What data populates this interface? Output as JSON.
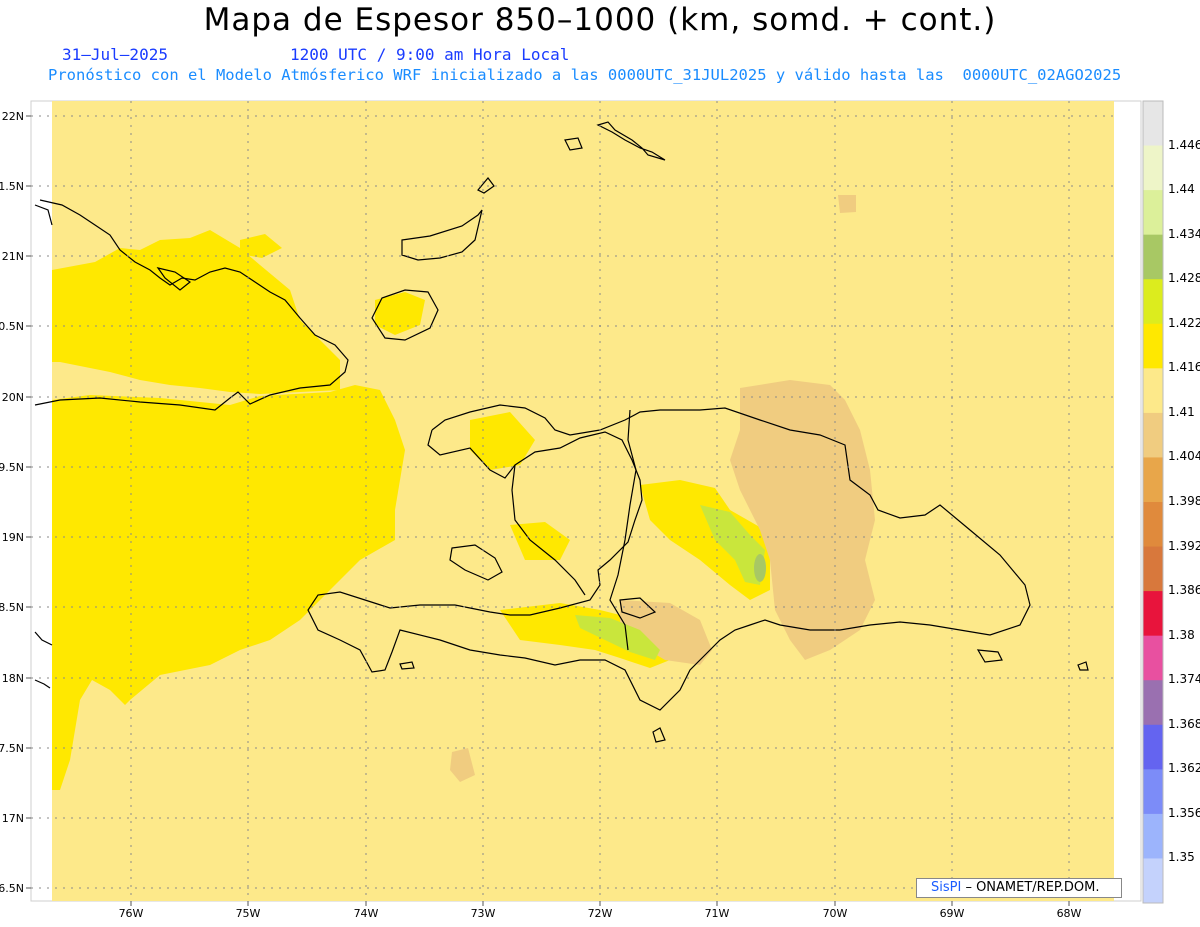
{
  "header": {
    "title": "Mapa de Espesor 850–1000 (km, somd. + cont.)",
    "date": "31–Jul–2025",
    "time": "1200 UTC / 9:00 am Hora Local",
    "forecast": "Pronóstico con el Modelo Atmósferico WRF inicializado a las 0000UTC_31JUL2025 y válido hasta las  0000UTC_02AGO2025"
  },
  "map": {
    "lat_labels": [
      "22N",
      "1.5N",
      "21N",
      "0.5N",
      "20N",
      "9.5N",
      "19N",
      "8.5N",
      "18N",
      "7.5N",
      "17N",
      "6.5N"
    ],
    "lon_labels": [
      "76W",
      "75W",
      "74W",
      "73W",
      "72W",
      "71W",
      "70W",
      "69W",
      "68W"
    ],
    "colors": {
      "base": "#fde98a",
      "high": "#ffe800",
      "low": "#f0cc80",
      "green": "#c9e63c",
      "coast": "#000000"
    }
  },
  "colorbar": {
    "labels": [
      "1.446",
      "1.44",
      "1.434",
      "1.428",
      "1.422",
      "1.416",
      "1.41",
      "1.404",
      "1.398",
      "1.392",
      "1.386",
      "1.38",
      "1.374",
      "1.368",
      "1.362",
      "1.356",
      "1.35"
    ],
    "colors": [
      "#e6e6e6",
      "#eef5c8",
      "#dcf09a",
      "#a8c864",
      "#dcec1e",
      "#ffe800",
      "#fde98a",
      "#f0cc80",
      "#e8a64a",
      "#e08a3c",
      "#d8783c",
      "#e8143c",
      "#e850a0",
      "#9a70b0",
      "#6464f0",
      "#7c8cf8",
      "#9cb4fc",
      "#c4d2fc"
    ]
  },
  "credit": {
    "sis": "SisPI",
    "text": " – ONAMET/REP.DOM."
  }
}
